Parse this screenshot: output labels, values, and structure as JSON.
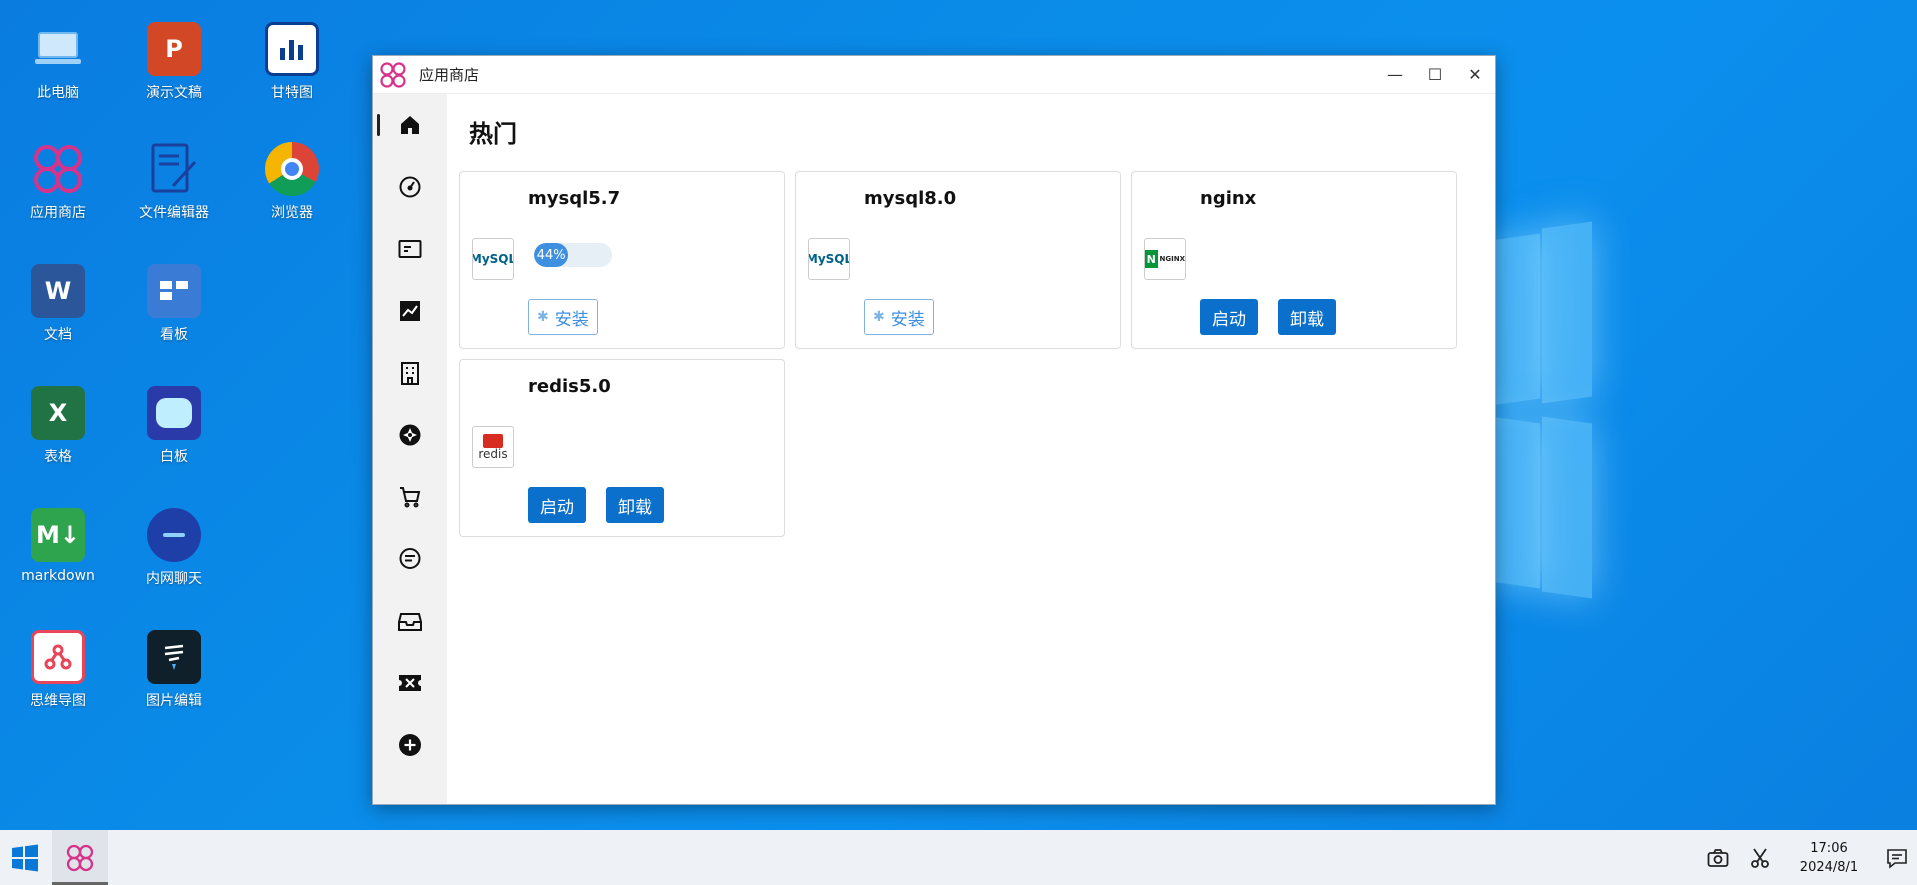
{
  "desktop": {
    "icons": [
      {
        "label": "此电脑",
        "icon": "computer-icon",
        "color": "#6fb8f0"
      },
      {
        "label": "演示文稿",
        "icon": "powerpoint-icon",
        "color": "#d24726"
      },
      {
        "label": "甘特图",
        "icon": "gantt-chart-icon",
        "color": "#0b3d91"
      },
      {
        "label": "应用商店",
        "icon": "app-store-icon",
        "color": "#d6338a"
      },
      {
        "label": "文件编辑器",
        "icon": "file-editor-icon",
        "color": "#1a3f9c"
      },
      {
        "label": "浏览器",
        "icon": "chrome-icon",
        "color": "#db4437"
      },
      {
        "label": "文档",
        "icon": "word-icon",
        "color": "#2b579a"
      },
      {
        "label": "看板",
        "icon": "kanban-icon",
        "color": "#3a7bd5"
      },
      {
        "label": "表格",
        "icon": "excel-icon",
        "color": "#217346"
      },
      {
        "label": "白板",
        "icon": "whiteboard-icon",
        "color": "#2a3aa8"
      },
      {
        "label": "markdown",
        "icon": "markdown-icon",
        "color": "#2ea44f"
      },
      {
        "label": "内网聊天",
        "icon": "chat-icon",
        "color": "#1f3fa8"
      },
      {
        "label": "思维导图",
        "icon": "mindmap-icon",
        "color": "#e8455a"
      },
      {
        "label": "图片编辑",
        "icon": "image-editor-icon",
        "color": "#10202a"
      }
    ]
  },
  "window": {
    "title": "应用商店",
    "controls": {
      "minimize": "—",
      "maximize": "☐",
      "close": "✕"
    }
  },
  "sidebar": {
    "items": [
      {
        "icon": "home-icon",
        "active": true
      },
      {
        "icon": "dashboard-icon"
      },
      {
        "icon": "card-icon"
      },
      {
        "icon": "chart-icon"
      },
      {
        "icon": "building-icon"
      },
      {
        "icon": "aperture-icon"
      },
      {
        "icon": "cart-icon"
      },
      {
        "icon": "message-icon"
      },
      {
        "icon": "inbox-icon"
      },
      {
        "icon": "ticket-icon"
      },
      {
        "icon": "add-icon"
      }
    ]
  },
  "main": {
    "heading": "热门",
    "cards": [
      {
        "name": "mysql5.7",
        "logo": "mysql-logo",
        "logo_text": "MySQL",
        "progress": 44,
        "progress_label": "44%",
        "install_label": "安装"
      },
      {
        "name": "mysql8.0",
        "logo": "mysql-logo",
        "logo_text": "MySQL",
        "install_label": "安装"
      },
      {
        "name": "nginx",
        "logo": "nginx-logo",
        "logo_text": "NGINX",
        "start_label": "启动",
        "uninstall_label": "卸载"
      },
      {
        "name": "redis5.0",
        "logo": "redis-logo",
        "logo_text": "redis",
        "start_label": "启动",
        "uninstall_label": "卸载"
      }
    ]
  },
  "taskbar": {
    "time": "17:06",
    "date": "2024/8/1"
  },
  "colors": {
    "accent": "#0b6fcc",
    "progress": "#3d8fe0"
  }
}
